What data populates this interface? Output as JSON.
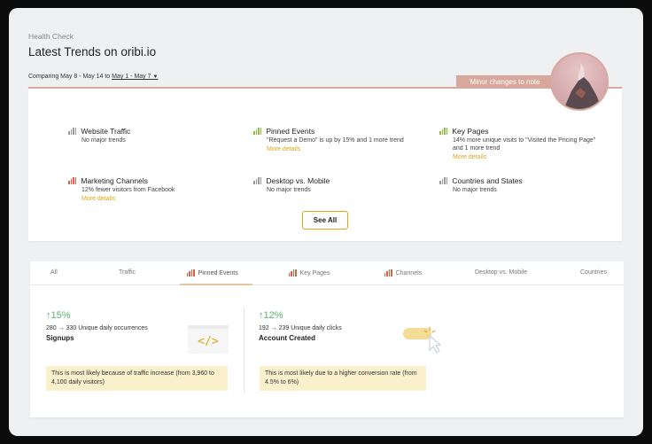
{
  "header": {
    "breadcrumb": "Health Check",
    "title": "Latest Trends on oribi.io",
    "compare_label": "Comparing May 8 - May 14 to",
    "compare_range": "May 1 - May 7",
    "banner": "Minor changes to note"
  },
  "summary": {
    "items": [
      {
        "title": "Website Traffic",
        "desc": "No major trends",
        "more": "",
        "icon": "bar-chart-gray-icon"
      },
      {
        "title": "Pinned Events",
        "desc": "\"Request a Demo\" is up by 15% and 1 more trend",
        "more": "More details",
        "icon": "bar-chart-green-icon"
      },
      {
        "title": "Key Pages",
        "desc": "14% more unique visits to \"Visited the Pricing Page\" and 1 more trend",
        "more": "More details",
        "icon": "bar-chart-green-icon"
      },
      {
        "title": "Marketing Channels",
        "desc": "12% fewer visitors from Facebook",
        "more": "More details",
        "icon": "bar-chart-red-icon"
      },
      {
        "title": "Desktop vs. Mobile",
        "desc": "No major trends",
        "more": "",
        "icon": "bar-chart-gray-icon"
      },
      {
        "title": "Countries and States",
        "desc": "No major trends",
        "more": "",
        "icon": "bar-chart-gray-icon"
      }
    ],
    "see_all": "See All"
  },
  "tabs": [
    {
      "label": "All",
      "icon": ""
    },
    {
      "label": "Traffic",
      "icon": ""
    },
    {
      "label": "Pinned Events",
      "icon": "bar-chart-red-icon"
    },
    {
      "label": "Key Pages",
      "icon": "bar-chart-red-icon"
    },
    {
      "label": "Channels",
      "icon": "bar-chart-red-icon"
    },
    {
      "label": "Desktop vs. Mobile",
      "icon": ""
    },
    {
      "label": "Countries",
      "icon": ""
    }
  ],
  "active_tab": "Pinned Events",
  "metrics": [
    {
      "pct": "15%",
      "counts": "280 → 330 Unique daily occurrences",
      "name": "Signups",
      "note": "This is most likely because of traffic increase (from  3,960 to 4,100 daily visitors)"
    },
    {
      "pct": "12%",
      "counts": "192 → 239 Unique daily clicks",
      "name": "Account Created",
      "note": "This is most likely due to a higher conversion rate (from 4.5% to 6%)"
    }
  ],
  "colors": {
    "accent": "#d9a89c",
    "link": "#e0a51d",
    "positive": "#59b36a",
    "note_bg": "#fbf0cc"
  }
}
